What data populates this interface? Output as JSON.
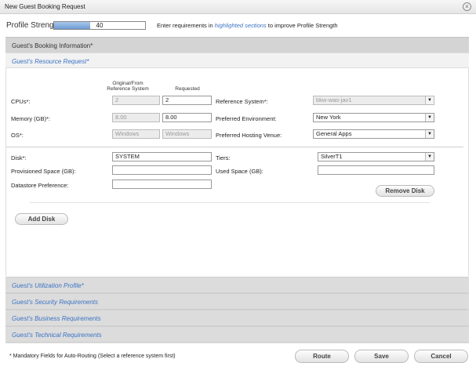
{
  "window": {
    "title": "New Guest Booking Request"
  },
  "profile": {
    "label": "Profile Strength:",
    "value": "40",
    "fraction": 0.4,
    "hint_prefix": "Enter requirements in ",
    "hint_highlight": "highlighted sections",
    "hint_suffix": " to improve Profile Strength"
  },
  "sections": {
    "booking_info": "Guest's Booking Information*",
    "resource_request": "Guest's Resource Request*",
    "utilization": "Guest's Utilization Profile*",
    "security": "Guest's Security Requirements",
    "business": "Guest's Business Requirements",
    "technical": "Guest's Technical Requirements"
  },
  "columns": {
    "original": "Original/From Reference System",
    "requested": "Requested"
  },
  "resources": {
    "cpus": {
      "label": "CPUs*:",
      "original": "2",
      "requested": "2"
    },
    "memory": {
      "label": "Memory (GB)*:",
      "original": "8.00",
      "requested": "8.00"
    },
    "os": {
      "label": "OS*:",
      "original": "Windows",
      "requested": "Windows"
    },
    "reference_system": {
      "label": "Reference System*:",
      "value": "bkw-was-jav1"
    },
    "preferred_env": {
      "label": "Preferred Environment:",
      "value": "New York"
    },
    "hosting_venue": {
      "label": "Preferred Hosting Venue:",
      "value": "General Apps"
    }
  },
  "disk": {
    "disk_label": "Disk*:",
    "disk_value": "SYSTEM",
    "tiers_label": "Tiers:",
    "tiers_value": "SilverT1",
    "prov_label": "Provisioned Space (GB):",
    "prov_value": "",
    "used_label": "Used Space (GB):",
    "used_value": "",
    "datastore_label": "Datastore Preference:",
    "datastore_value": "",
    "remove_label": "Remove Disk",
    "add_label": "Add Disk"
  },
  "footer": {
    "note": "* Mandatory Fields for Auto-Routing (Select a reference system first)",
    "route": "Route",
    "save": "Save",
    "cancel": "Cancel"
  }
}
